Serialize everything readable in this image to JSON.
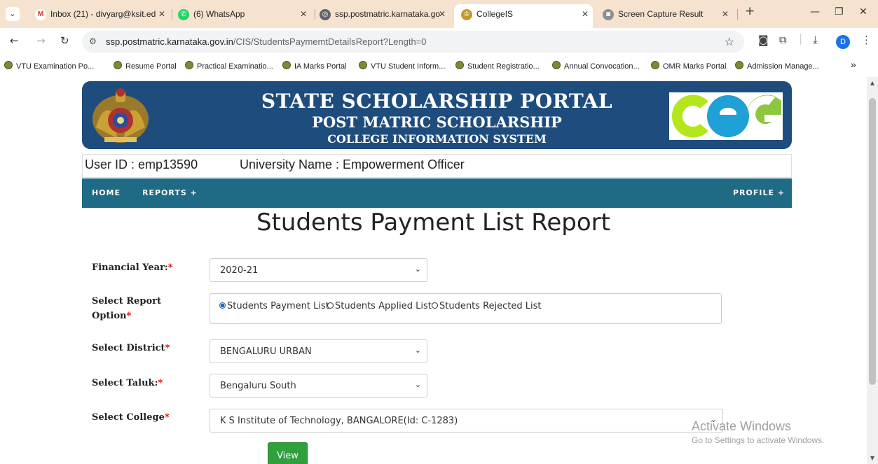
{
  "browser": {
    "tabs": [
      {
        "title": "Inbox (21) - divyarg@ksit.ed",
        "active": false
      },
      {
        "title": "(6) WhatsApp",
        "active": false
      },
      {
        "title": "ssp.postmatric.karnataka.go",
        "active": false
      },
      {
        "title": "CollegeIS",
        "active": true
      },
      {
        "title": "Screen Capture Result",
        "active": false
      }
    ],
    "new_tab_icon": "+",
    "url_domain": "ssp.postmatric.karnataka.gov.in",
    "url_path": "/CIS/StudentsPaymemtDetailsReport?Length=0",
    "profile_initial": "D",
    "bookmarks": [
      "VTU Examination Po...",
      "Resume Portal",
      "Practical Examinatio...",
      "IA Marks Portal",
      "VTU Student Inform...",
      "Student Registratio...",
      "Annual Convocation...",
      "OMR Marks Portal",
      "Admission Manage..."
    ],
    "bookmarks_overflow": "»"
  },
  "header": {
    "title1": "STATE SCHOLARSHIP PORTAL",
    "title2": "POST MATRIC SCHOLARSHIP",
    "title3": "COLLEGE INFORMATION SYSTEM",
    "logo_text": "CEG"
  },
  "userbar": {
    "user_id": "User ID : emp13590",
    "university": "University Name : Empowerment Officer"
  },
  "nav": {
    "home": "HOME",
    "reports": "REPORTS +",
    "profile": "PROFILE +"
  },
  "page_title": "Students Payment List Report",
  "form": {
    "financial_year_label": "Financial Year:",
    "financial_year_value": "2020-21",
    "report_option_label_1": "Select Report",
    "report_option_label_2": "Option",
    "report_options": [
      "Students Payment List",
      "Students Applied List",
      "Students Rejected List"
    ],
    "selected_option": "Students Payment List",
    "district_label": "Select District",
    "district_value": "BENGALURU URBAN",
    "taluk_label": "Select Taluk:",
    "taluk_value": "Bengaluru South",
    "college_label": "Select College",
    "college_value": "K S Institute of Technology, BANGALORE(Id: C-1283)",
    "required_mark": "*",
    "view_button": "View"
  },
  "watermark": {
    "line1": "Activate Windows",
    "line2": "Go to Settings to activate Windows."
  },
  "colors": {
    "tab_strip": "#f6e3cf",
    "banner": "#1e4d7d",
    "menubar": "#1f6a85",
    "view_button": "#2fa03c",
    "required": "#dd0000"
  }
}
